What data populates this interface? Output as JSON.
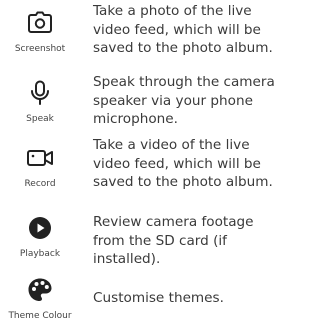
{
  "features": [
    {
      "label": "Screenshot",
      "icon": "camera-icon",
      "description": "Take a photo of the live video feed, which will be saved to the photo album."
    },
    {
      "label": "Speak",
      "icon": "microphone-icon",
      "description": "Speak through the camera speaker via your phone microphone."
    },
    {
      "label": "Record",
      "icon": "video-camera-icon",
      "description": "Take a video of the live video feed, which will be saved to the photo album."
    },
    {
      "label": "Playback",
      "icon": "play-circle-icon",
      "description": "Review camera footage from the SD card (if installed)."
    },
    {
      "label": "Theme Colour",
      "icon": "palette-icon",
      "description": "Customise themes."
    }
  ]
}
